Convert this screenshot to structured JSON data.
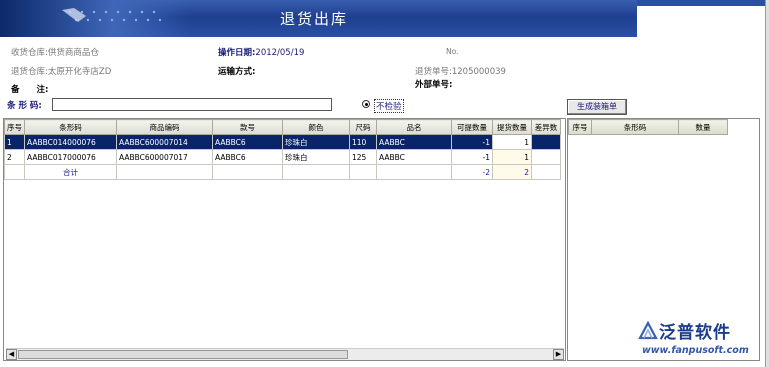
{
  "title": "退货出库",
  "header": {
    "receive_warehouse": "收货仓库:供货商商品仓",
    "operate_date_label": "操作日期:",
    "operate_date_value": "2012/05/19",
    "no_label": "No.",
    "return_warehouse": "退货仓库:太原开化寺店ZD",
    "transport_label": "运输方式:",
    "return_no": "退货单号:1205000039",
    "remark_label": "备　　注:",
    "external_no_label": "外部单号:"
  },
  "barcode": {
    "label": "条 形 码:",
    "value": ""
  },
  "no_check": {
    "label": "不检验",
    "checked": true
  },
  "generate_button": "生成装箱单",
  "main_table": {
    "columns": [
      "序号",
      "条形码",
      "商品编码",
      "款号",
      "颜色",
      "尺码",
      "品名",
      "可提数量",
      "提货数量",
      "差异数"
    ],
    "rows": [
      [
        "1",
        "AABBC014000076",
        "AABBC600007014",
        "AABBC6",
        "珍珠白",
        "110",
        "AABBC",
        "-1",
        "1",
        ""
      ],
      [
        "2",
        "AABBC017000076",
        "AABBC600007017",
        "AABBC6",
        "珍珠白",
        "125",
        "AABBC",
        "-1",
        "1",
        ""
      ]
    ],
    "total_row": {
      "label": "合计",
      "available": "-2",
      "pick": "2"
    }
  },
  "side_table": {
    "columns": [
      "序号",
      "条形码",
      "数量"
    ]
  },
  "logo": {
    "name": "泛普软件",
    "url": "www.fanpusoft.com"
  }
}
